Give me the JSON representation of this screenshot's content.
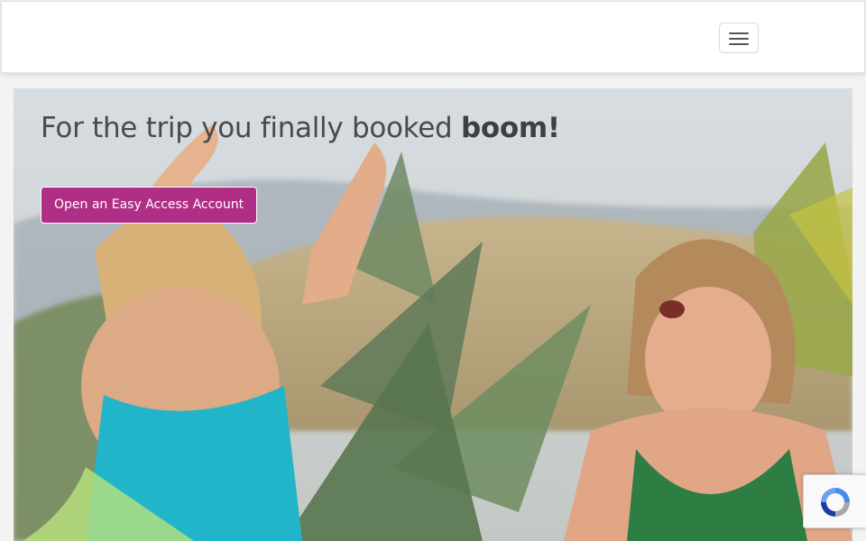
{
  "header": {
    "menu_icon": "hamburger-icon"
  },
  "hero": {
    "title_regular": "For the trip you finally booked ",
    "title_bold": "boom!",
    "cta_label": "Open an Easy Access Account",
    "cta_color": "#b02f86",
    "image_description_icon": "hero-photo"
  },
  "recaptcha": {
    "icon": "recaptcha-icon"
  }
}
